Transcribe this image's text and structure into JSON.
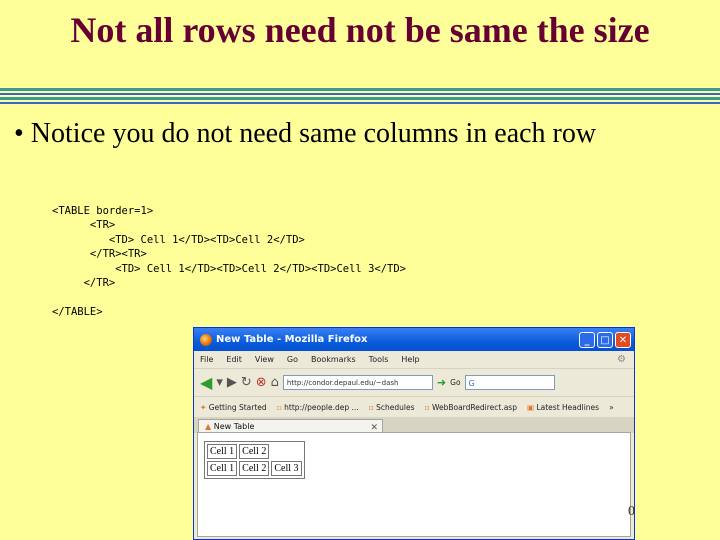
{
  "slide": {
    "title": "Not all rows need not be same the size",
    "bullet": "• Notice you do  not need same columns in each row",
    "code": "<TABLE border=1>\n      <TR>\n         <TD> Cell 1</TD><TD>Cell 2</TD>\n      </TR><TR>\n          <TD> Cell 1</TD><TD>Cell 2</TD><TD>Cell 3</TD>\n     </TR>\n\n</TABLE>",
    "page_number": "0"
  },
  "browser": {
    "window_title": "New Table - Mozilla Firefox",
    "menu": [
      "File",
      "Edit",
      "View",
      "Go",
      "Bookmarks",
      "Tools",
      "Help"
    ],
    "url": "http://condor.depaul.edu/~dash",
    "go_label": "Go",
    "search_placeholder": "G",
    "bookmarks": [
      "Getting Started",
      "http://people.dep ...",
      "Schedules",
      "WebBoardRedirect.asp",
      "Latest Headlines"
    ],
    "bookmarks_more": "»",
    "tab_label": "New Table",
    "demo_table": [
      [
        "Cell 1",
        "Cell 2"
      ],
      [
        "Cell 1",
        "Cell 2",
        "Cell 3"
      ]
    ]
  },
  "colors": {
    "background": "#ffff99",
    "title": "#660033",
    "rule_teal": "#3a9a9a",
    "rule_blue": "#3366cc"
  }
}
